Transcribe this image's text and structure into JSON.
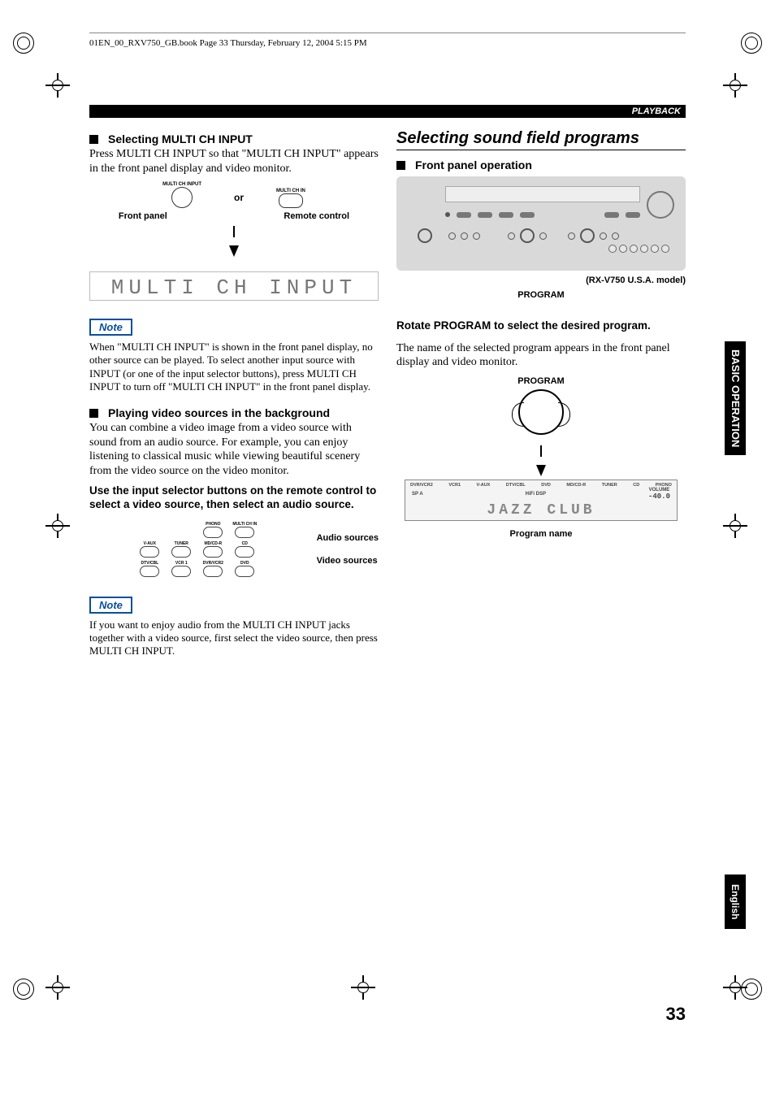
{
  "crop_header": "01EN_00_RXV750_GB.book  Page 33  Thursday, February 12, 2004  5:15 PM",
  "playback_label": "PLAYBACK",
  "page_number": "33",
  "side_tab_op_line1": "BASIC",
  "side_tab_op_line2": "OPERATION",
  "side_tab_lang": "English",
  "left": {
    "h1": "Selecting MULTI CH INPUT",
    "p1": "Press MULTI CH INPUT so that \"MULTI CH INPUT\" appears in the front panel display and video monitor.",
    "diag": {
      "fp_label": "MULTI CH INPUT",
      "fp_caption": "Front panel",
      "or": "or",
      "rc_label": "MULTI CH IN",
      "rc_caption": "Remote control"
    },
    "lcd": "MULTI CH INPUT",
    "note1_title": "Note",
    "note1_body": "When \"MULTI CH INPUT\" is shown in the front panel display, no other source can be played. To select another input source with INPUT (or one of the input selector buttons), press MULTI CH INPUT to turn off \"MULTI CH INPUT\" in the front panel display.",
    "h2": "Playing video sources in the background",
    "p2": "You can combine a video image from a video source with sound from an audio source. For example, you can enjoy listening to classical music while viewing beautiful scenery from the video source on the video monitor.",
    "instr": "Use the input selector buttons on the remote control to select a video source, then select an audio source.",
    "remote_labels": {
      "r1": [
        "",
        "",
        "PHONO",
        "MULTI CH IN"
      ],
      "r2": [
        "V-AUX",
        "TUNER",
        "MD/CD-R",
        "CD"
      ],
      "r3": [
        "DTV/CBL",
        "VCR 1",
        "DVR/VCR2",
        "DVD"
      ]
    },
    "audio_caption": "Audio sources",
    "video_caption": "Video sources",
    "note2_title": "Note",
    "note2_body": "If you want to enjoy audio from the MULTI CH INPUT jacks together with a video source, first select the video source, then press MULTI CH INPUT."
  },
  "right": {
    "h1": "Selecting sound field programs",
    "h2": "Front panel operation",
    "model": "(RX-V750 U.S.A. model)",
    "program_label": "PROGRAM",
    "instr": "Rotate PROGRAM to select the desired program.",
    "p1": "The name of the selected program appears in the front panel display and video monitor.",
    "knob_caption": "PROGRAM",
    "display": {
      "sources": [
        "DVR/VCR2",
        "VCR1",
        "V-AUX",
        "DTV/CBL",
        "DVD",
        "MD/CD-R",
        "TUNER",
        "CD",
        "PHONO"
      ],
      "sp": "SP A",
      "hifi": "HiFi DSP",
      "vol_lbl": "VOLUME",
      "vol_val": "-40.0",
      "main": "JAZZ CLUB"
    },
    "prog_caption": "Program name"
  }
}
